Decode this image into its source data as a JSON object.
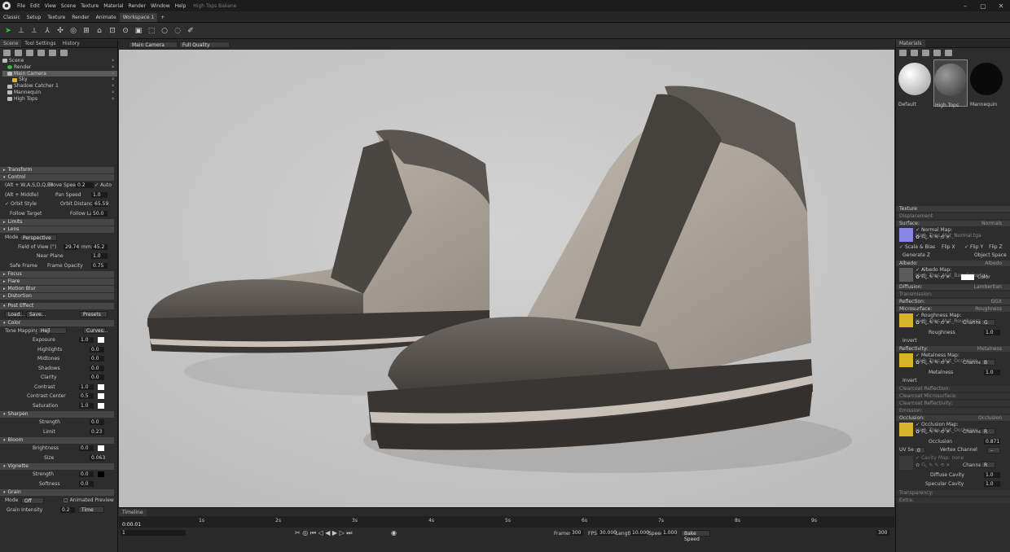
{
  "app": {
    "menus": [
      "File",
      "Edit",
      "View",
      "Scene",
      "Texture",
      "Material",
      "Render",
      "Window",
      "Help"
    ],
    "title": "High Tops Bakene",
    "window_controls": [
      "–",
      "▢",
      "✕"
    ]
  },
  "modes": [
    "Classic",
    "Setup",
    "Texture",
    "Render",
    "Animate",
    "Workspace 1",
    "+"
  ],
  "scene_panel": {
    "tabs": [
      "Scene",
      "Tool Settings",
      "History"
    ],
    "tree": [
      {
        "label": "Scene",
        "indent": 0
      },
      {
        "label": "Render",
        "indent": 1
      },
      {
        "label": "Main Camera",
        "indent": 1,
        "selected": true
      },
      {
        "label": "Sky",
        "indent": 1
      },
      {
        "label": "Shadow Catcher 1",
        "indent": 1
      },
      {
        "label": "Mannequin",
        "indent": 1
      },
      {
        "label": "High Tops",
        "indent": 1
      }
    ]
  },
  "props": {
    "transform": "Transform",
    "control": "Control",
    "ctl_hint1": "(Alt + W,A,S,D,Q,E)",
    "move_speed_label": "Move Speed:",
    "move_speed": "0.2",
    "auto_label": "Auto",
    "ctl_hint2": "(Alt + Middle)",
    "pan_speed_label": "Pan Speed",
    "pan_speed": "1.0",
    "orbit_style": "Orbit Style",
    "orbit_distance_label": "Orbit Distance:",
    "orbit_distance": "65.59",
    "follow_target": "Follow Target",
    "follow_lag_label": "Follow Lag",
    "follow_lag": "50.0",
    "limits": "Limits",
    "lens": "Lens",
    "mode_label": "Mode",
    "mode_value": "Perspective",
    "fov_label": "Field of View (°)",
    "fov": "29.74",
    "mm_label": "mm:",
    "mm": "45.2",
    "near_plane_label": "Near Plane",
    "near_plane": "1.0",
    "safe_frame": "Safe Frame",
    "frame_opacity_label": "Frame Opacity",
    "frame_opacity": "0.75",
    "focus": "Focus",
    "flare": "Flare",
    "motion_blur": "Motion Blur",
    "distortion": "Distortion",
    "post_effect": "Post Effect",
    "load": "Load...",
    "save": "Save...",
    "presets": "Presets",
    "color": "Color",
    "tone_mapping_label": "Tone Mapping",
    "tone_mapping": "Hejl",
    "curves": "Curves...",
    "exposure_label": "Exposure",
    "exposure": "1.0",
    "highlights_label": "Highlights",
    "highlights": "0.0",
    "midtones_label": "Midtones",
    "midtones": "0.0",
    "shadows_label": "Shadows",
    "shadows": "0.0",
    "clarity_label": "Clarity",
    "clarity": "0.0",
    "contrast_label": "Contrast",
    "contrast": "1.0",
    "contrast_center_label": "Contrast Center",
    "contrast_center": "0.5",
    "saturation_label": "Saturation",
    "saturation": "1.0",
    "sharpen": "Sharpen",
    "strength_label": "Strength",
    "strength": "0.0",
    "limit_label": "Limit",
    "limit": "0.23",
    "bloom": "Bloom",
    "brightness_label": "Brightness",
    "brightness": "0.0",
    "size_label": "Size",
    "size": "0.063",
    "vignette": "Vignette",
    "v_strength": "0.0",
    "softness_label": "Softness",
    "softness": "0.0",
    "grain": "Grain",
    "grain_mode_label": "Mode",
    "grain_mode": "Off",
    "animated_preview": "Animated Preview",
    "grain_intensity_label": "Grain Intensity",
    "grain_intensity": "0.2",
    "grain_time": "Time"
  },
  "viewport": {
    "camera": "Main Camera",
    "quality": "Full Quality"
  },
  "timeline": {
    "tab": "Timeline",
    "time": "0:00.01",
    "ticks": [
      "1s",
      "2s",
      "3s",
      "4s",
      "5s",
      "6s",
      "7s",
      "8s",
      "9s"
    ],
    "frame_field": "1",
    "frames_label": "Frames",
    "frames": "300",
    "fps_label": "FPS",
    "fps": "30.000",
    "length_label": "Length",
    "length": "10.000",
    "speed_label": "Speed",
    "speed": "1.000",
    "bake_speed": "Bake Speed",
    "end_frame": "300"
  },
  "materials": {
    "title": "Materials",
    "balls": [
      "Default",
      "High Tops",
      "Mannequin"
    ],
    "texture": "Texture",
    "displacement": "Displacement",
    "surface": "Surface:",
    "surface_val": "Normals",
    "normal_map_label": "Normal Map:",
    "normal_map": "High_Tops_Mat_Normal.tga",
    "scale_bias": "Scale & Bias",
    "flip_x": "Flip X",
    "flip_y": "Flip Y",
    "flip_z": "Flip Z",
    "generate_z": "Generate Z",
    "object_space": "Object Space",
    "albedo": "Albedo:",
    "albedo_val": "Albedo",
    "albedo_map_label": "Albedo Map:",
    "albedo_map": "High_Tops_Mat_BaseColor.tga",
    "color_label": "Color",
    "diffusion": "Diffusion:",
    "diffusion_val": "Lambertian",
    "transmission": "Transmission:",
    "reflection": "Reflection:",
    "reflection_val": "GGX",
    "microsurface": "Microsurface:",
    "microsurface_val": "Roughness",
    "roughness_map_label": "Roughness Map:",
    "roughness_map": "High_Tops_Mat_Roughness",
    "channel_label": "Channel",
    "roughness_channel": "G",
    "roughness_label": "Roughness",
    "roughness": "1.0",
    "invert": "Invert",
    "reflectivity": "Reflectivity:",
    "reflectivity_val": "Metalness",
    "metalness_map_label": "Metalness Map:",
    "metalness_map": "High_Tops_Mat_Occlusion",
    "metal_channel": "B",
    "metalness_label": "Metalness",
    "metalness": "1.0",
    "clearcoat_reflection": "Clearcoat Reflection:",
    "clearcoat_micro": "Clearcoat Microsurface:",
    "clearcoat_reflectivity": "Clearcoat Reflectivity:",
    "emission": "Emission:",
    "occlusion": "Occlusion:",
    "occlusion_val": "Occlusion",
    "occlusion_map_label": "Occlusion Map:",
    "occlusion_map": "High_Tops_Mat_Occlusion",
    "occ_channel": "R",
    "occlusion_label": "Occlusion",
    "occlusion_amt": "0.871",
    "uv_set_label": "UV Set",
    "uv_set": "0",
    "vertex_channel_label": "Vertex Channel",
    "vertex_channel": "–",
    "cavity_map_label": "Cavity Map:",
    "cavity_map": "none",
    "cav_channel": "R",
    "diffuse_cavity_label": "Diffuse Cavity",
    "diffuse_cavity": "1.0",
    "specular_cavity_label": "Specular Cavity",
    "specular_cavity": "1.0",
    "transparency": "Transparency:",
    "extra": "Extra:"
  }
}
